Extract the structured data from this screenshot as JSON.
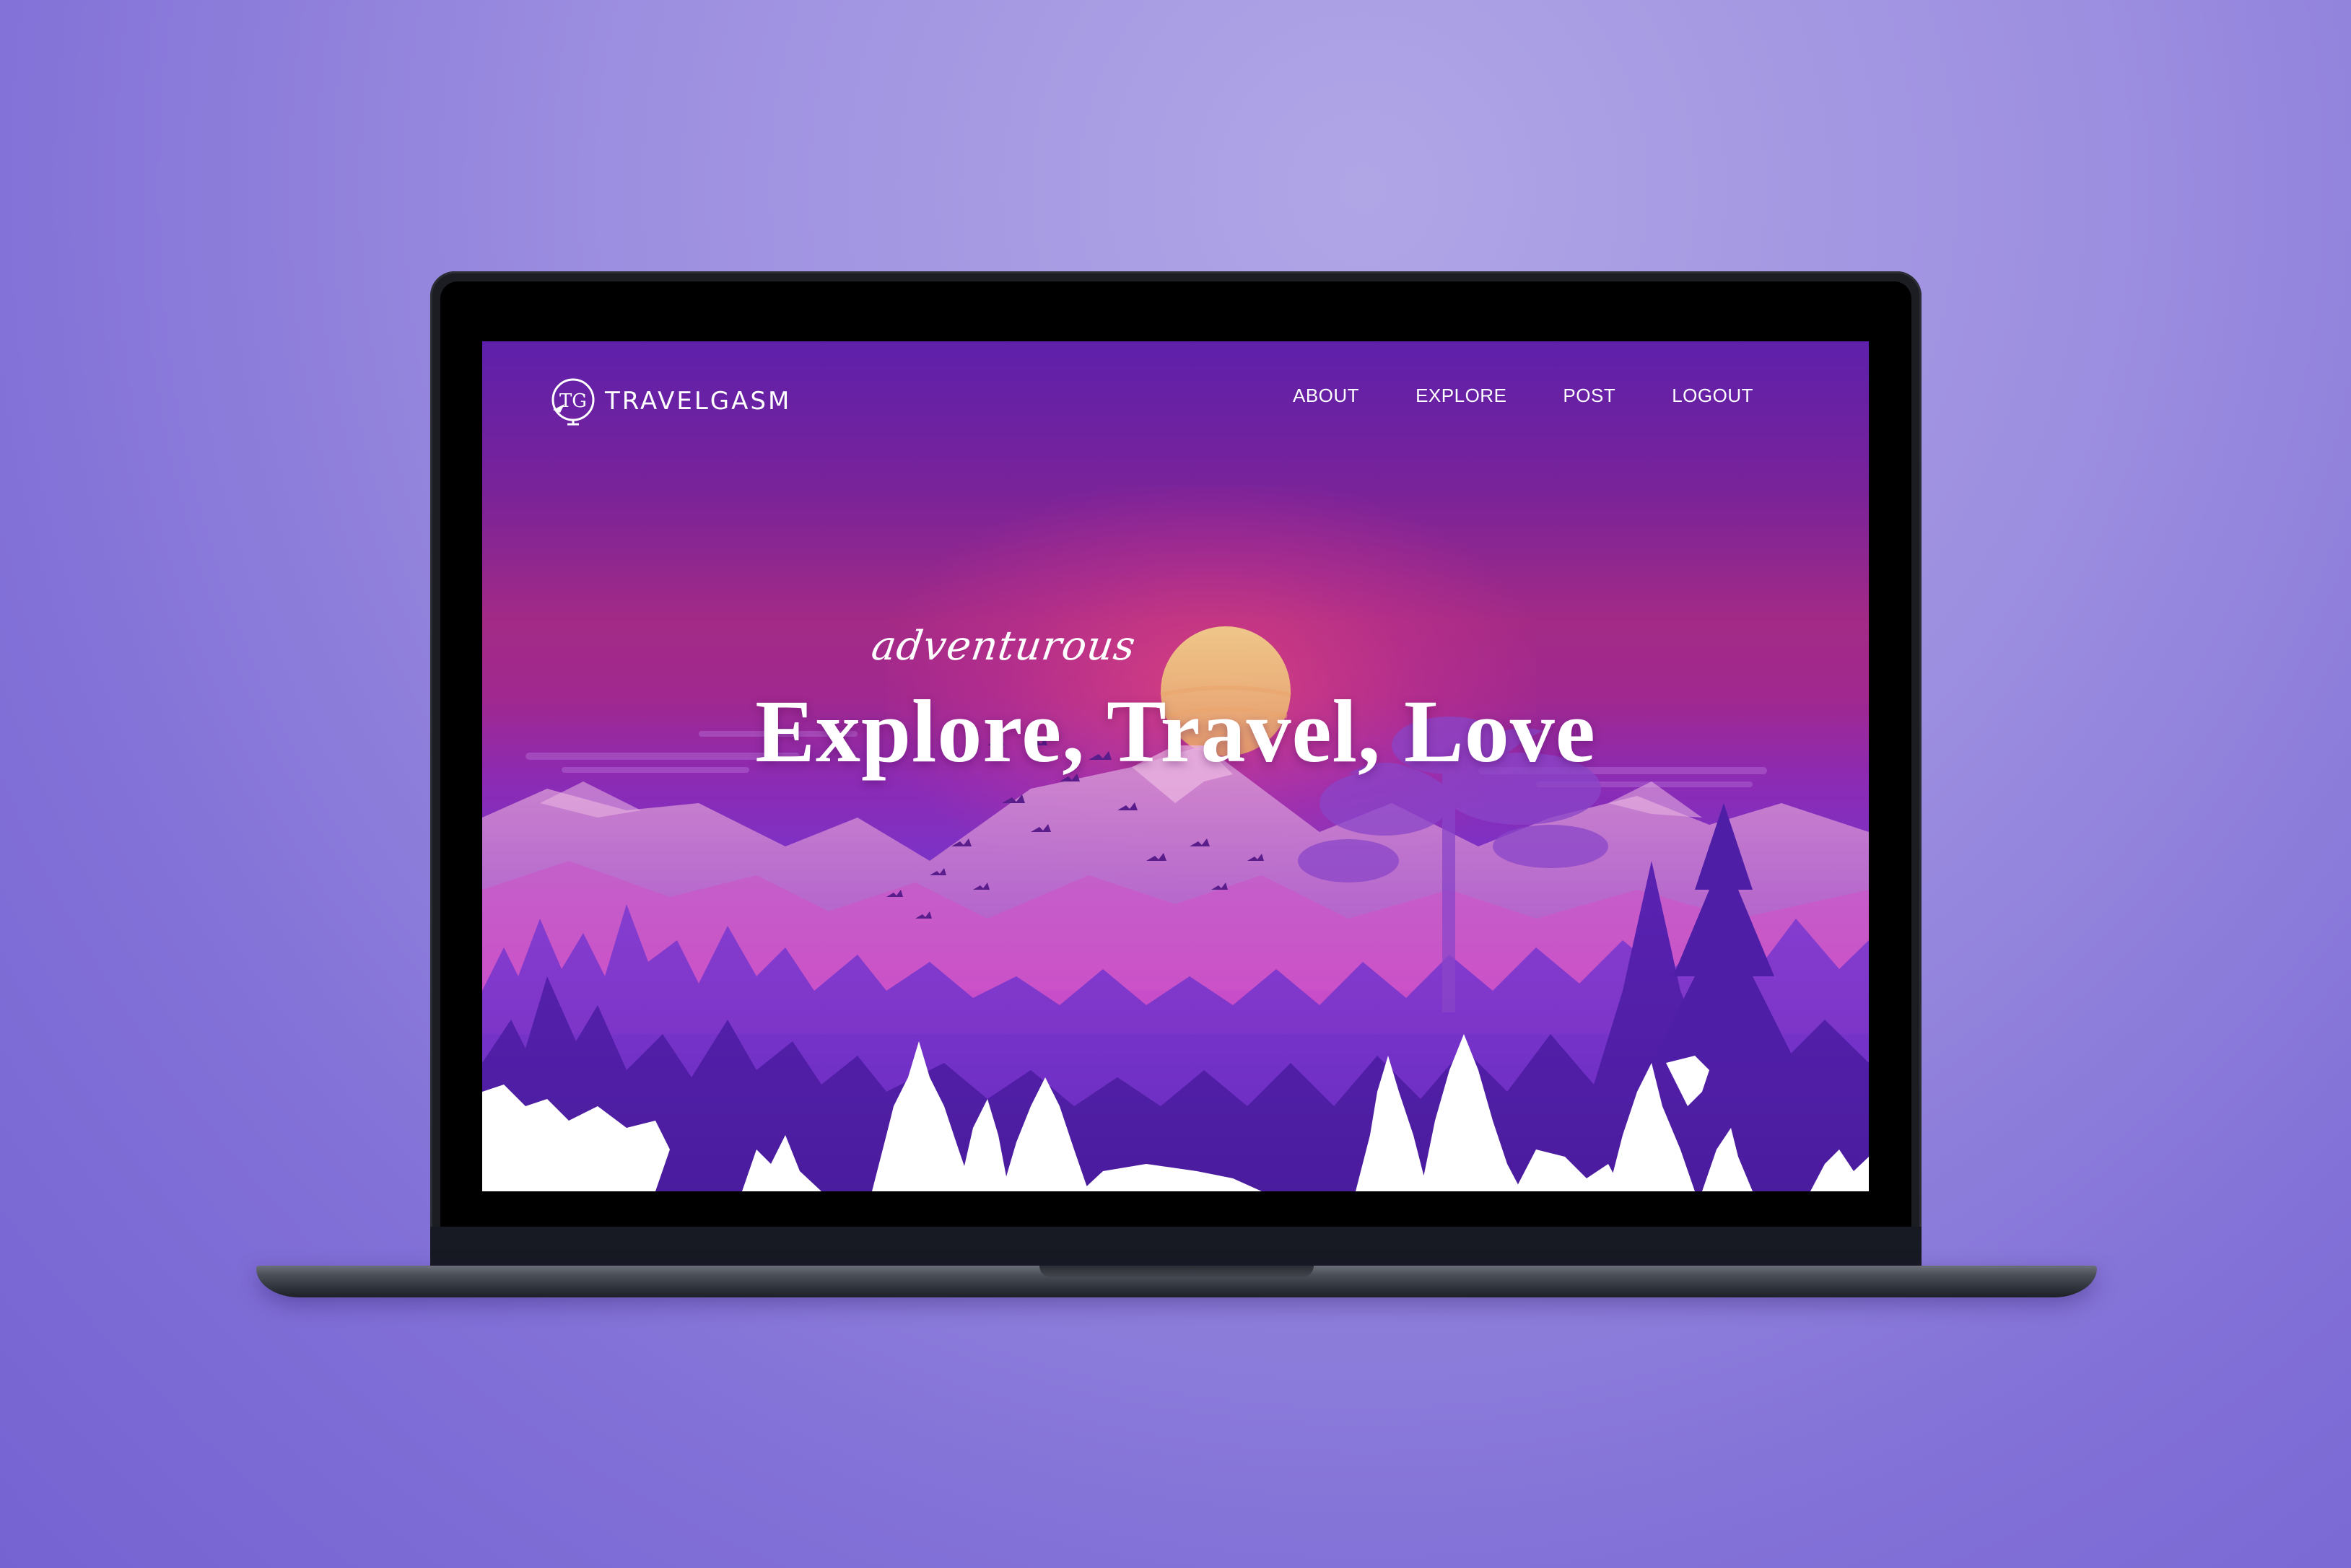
{
  "brand": {
    "monogram": "TG",
    "name": "TRAVELGASM"
  },
  "nav": {
    "items": [
      {
        "label": "ABOUT"
      },
      {
        "label": "EXPLORE"
      },
      {
        "label": "POST"
      },
      {
        "label": "LOGOUT"
      }
    ]
  },
  "hero": {
    "script_text": "adventurous",
    "title": "Explore, Travel, Love"
  },
  "colors": {
    "background": "#9d8fe0",
    "screen_top": "#5e20ab",
    "sun": "#f2c97a",
    "text": "#ffffff"
  },
  "icons": {
    "logo": "paper-plane-globe-icon"
  }
}
